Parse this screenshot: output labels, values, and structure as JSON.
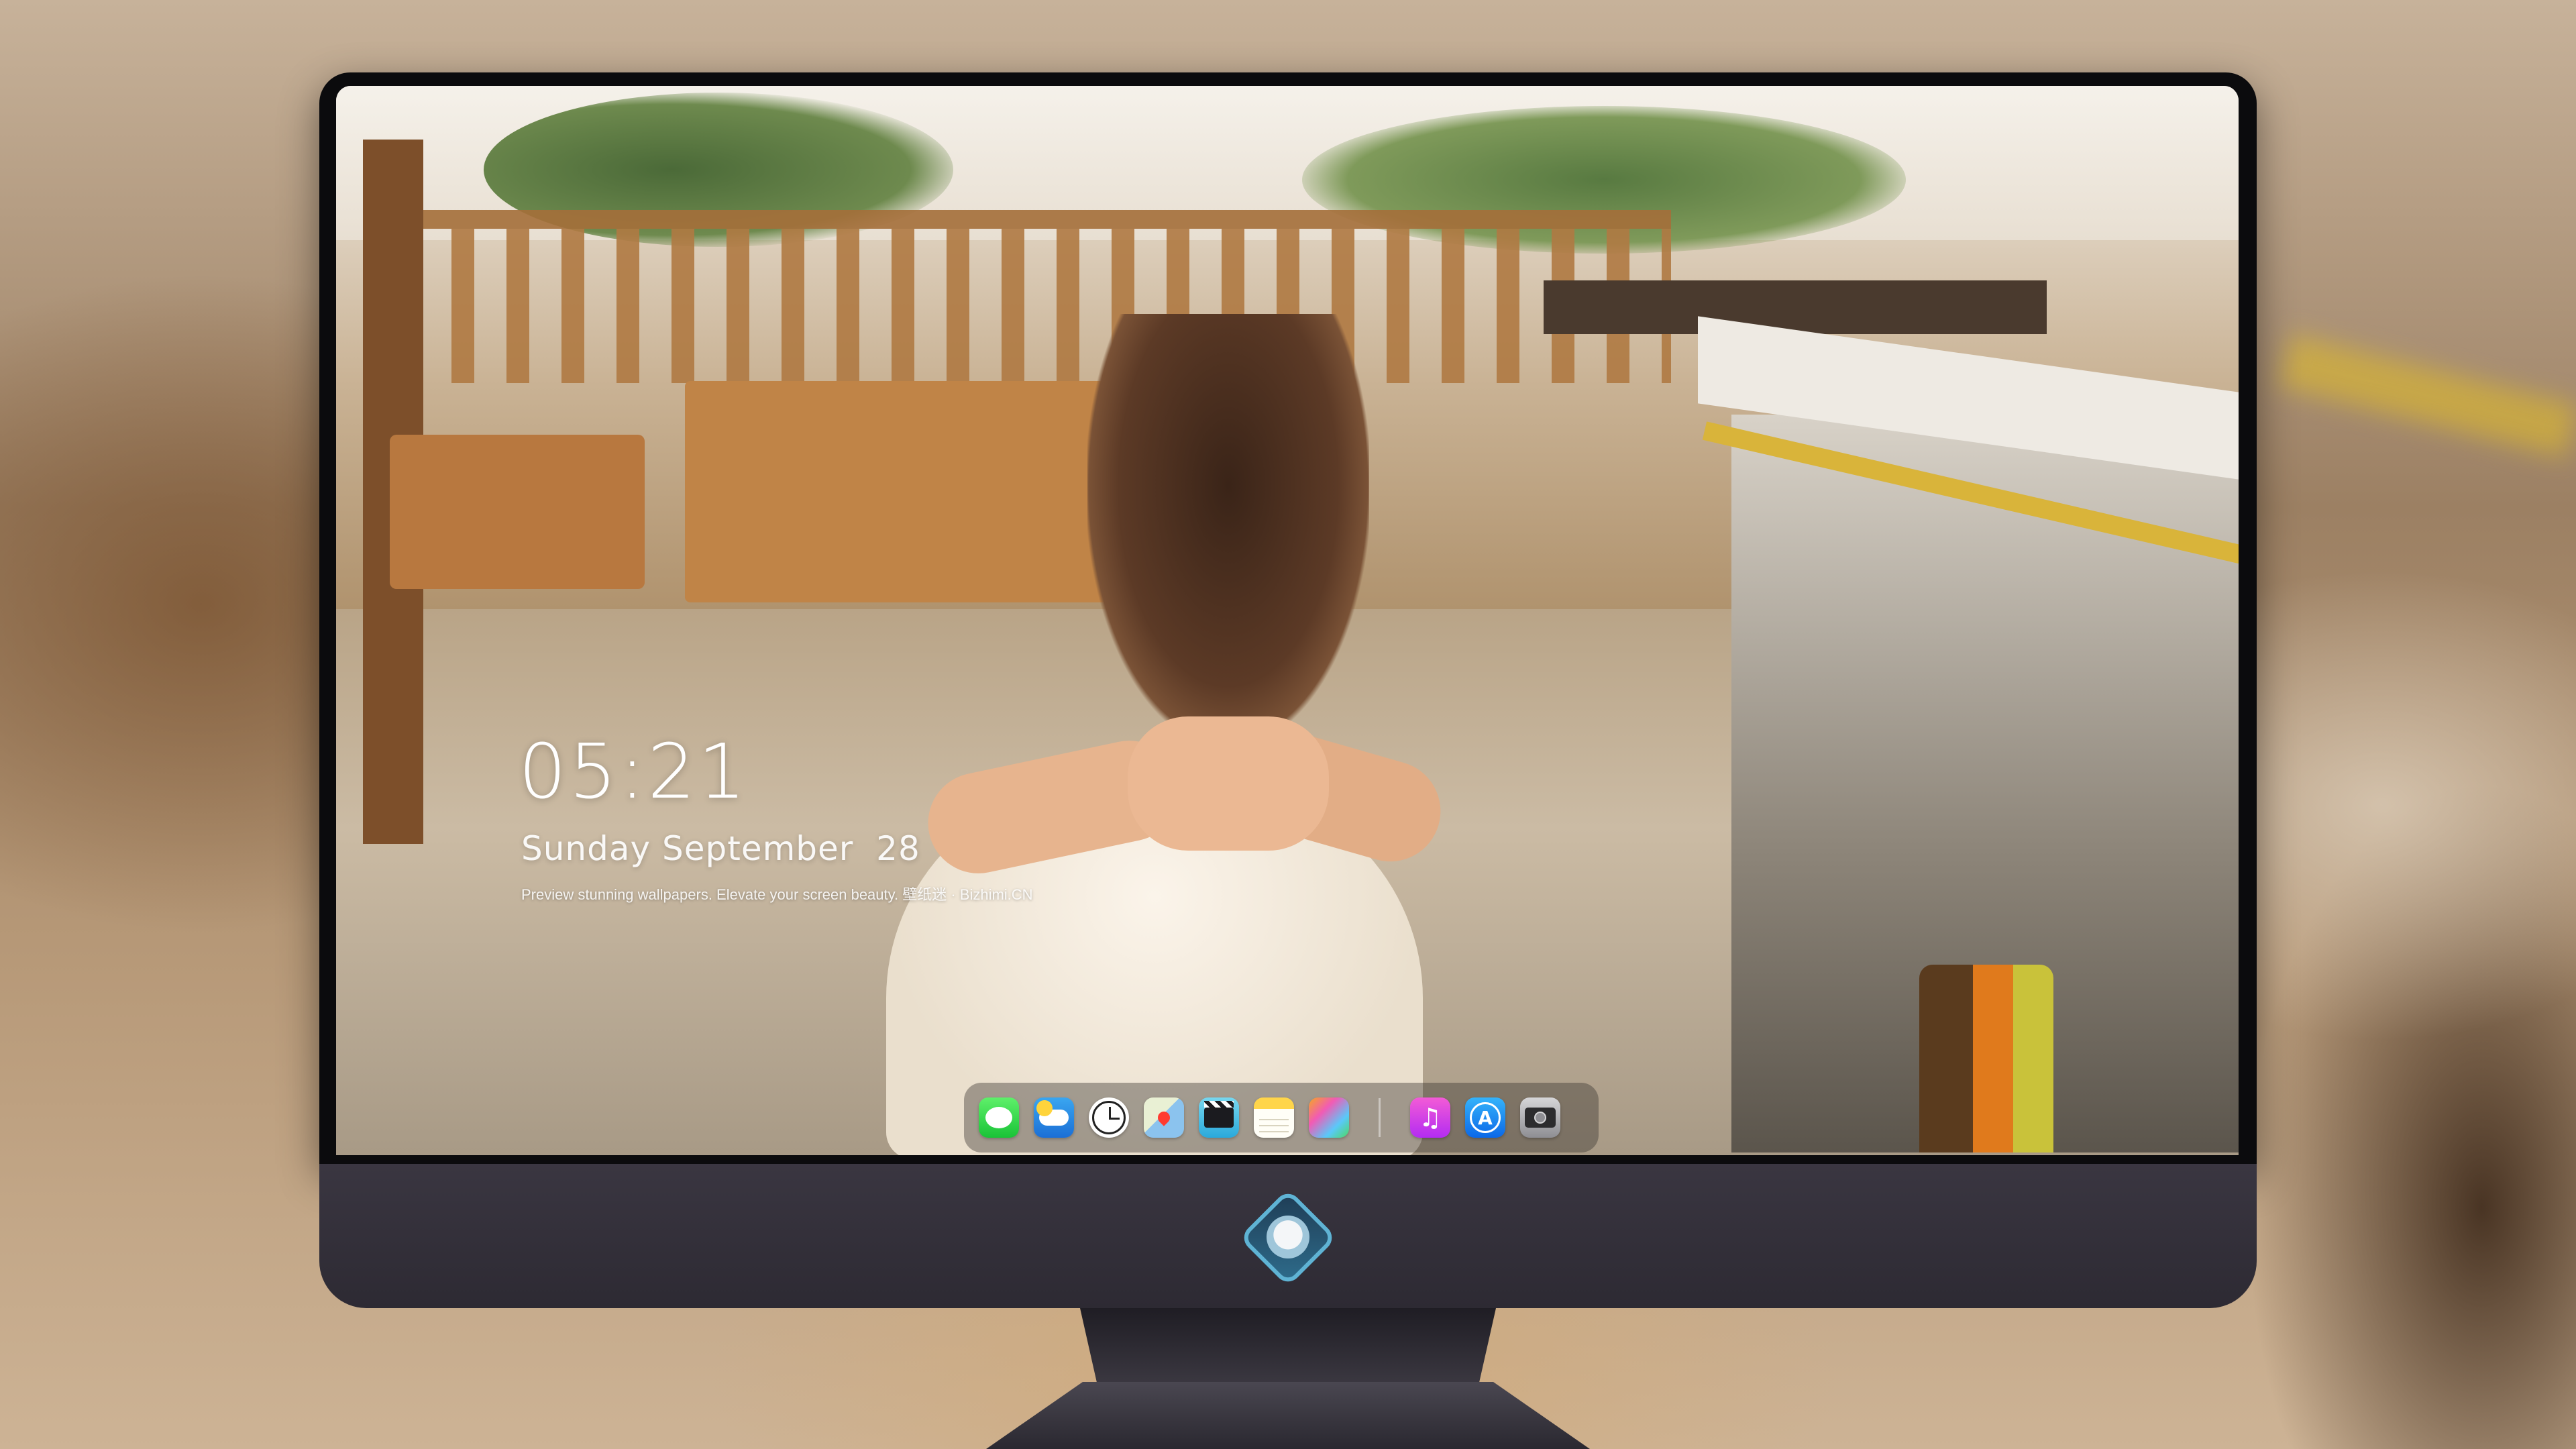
{
  "lock_screen": {
    "time": "05:21",
    "date": "Sunday September  28",
    "tagline": "Preview stunning wallpapers. Elevate your screen beauty. 壁纸迷 · Bizhimi.CN"
  },
  "dock": {
    "apps": [
      {
        "name": "Messages",
        "icon": "messages-icon"
      },
      {
        "name": "Weather",
        "icon": "weather-icon"
      },
      {
        "name": "Clock",
        "icon": "clock-icon"
      },
      {
        "name": "Maps",
        "icon": "maps-icon"
      },
      {
        "name": "Videos",
        "icon": "clapperboard-icon"
      },
      {
        "name": "Notes",
        "icon": "notes-icon"
      },
      {
        "name": "Photos",
        "icon": "photos-icon"
      },
      {
        "name": "Music",
        "icon": "music-icon"
      },
      {
        "name": "App Store",
        "icon": "appstore-icon"
      },
      {
        "name": "Camera",
        "icon": "camera-icon"
      }
    ],
    "music_glyph": "♫",
    "appstore_glyph": "A"
  },
  "colors": {
    "bezel": "#0b0b0d",
    "chin": "#2d2a33",
    "text": "#ffffff"
  }
}
